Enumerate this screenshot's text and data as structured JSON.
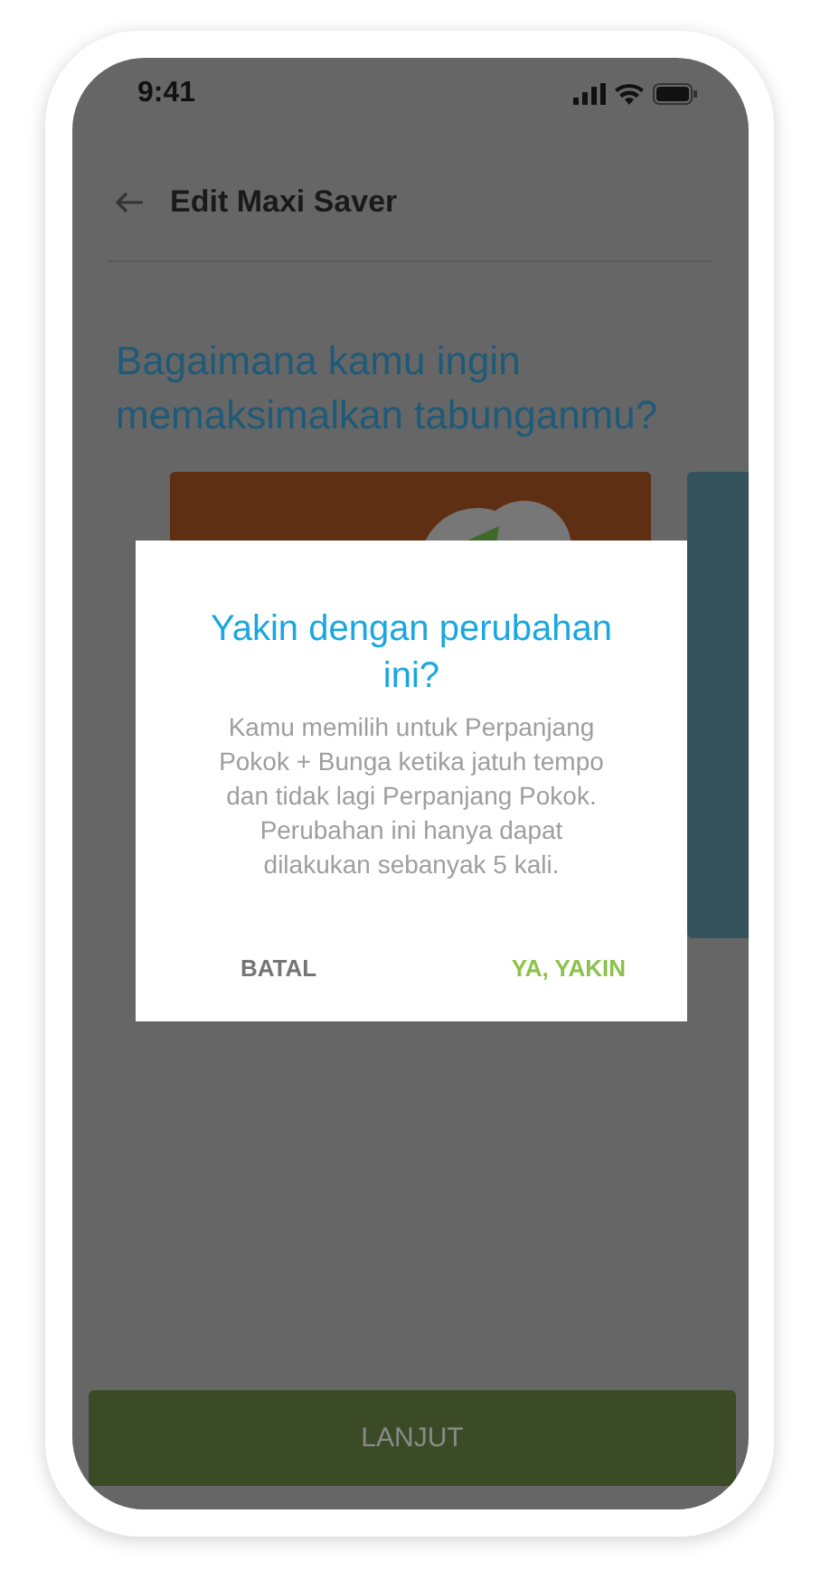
{
  "status_bar": {
    "time": "9:41"
  },
  "header": {
    "title": "Edit Maxi Saver"
  },
  "question": "Bagaimana kamu ingin memaksimalkan tabunganmu?",
  "cards": [
    {
      "kind": "picture"
    },
    {
      "kind": "plain"
    }
  ],
  "dialog": {
    "title": "Yakin dengan perubahan ini?",
    "message": "Kamu memilih untuk Perpanjang Pokok + Bunga ketika jatuh tempo dan tidak lagi Perpanjang Pokok. Perubahan ini hanya dapat dilakukan sebanyak 5 kali.",
    "buttons": [
      {
        "label": "BATAL",
        "kind": "cancel"
      },
      {
        "label": "YA, YAKIN",
        "kind": "confirm"
      }
    ]
  },
  "primary_button": {
    "label": "LANJUT"
  }
}
